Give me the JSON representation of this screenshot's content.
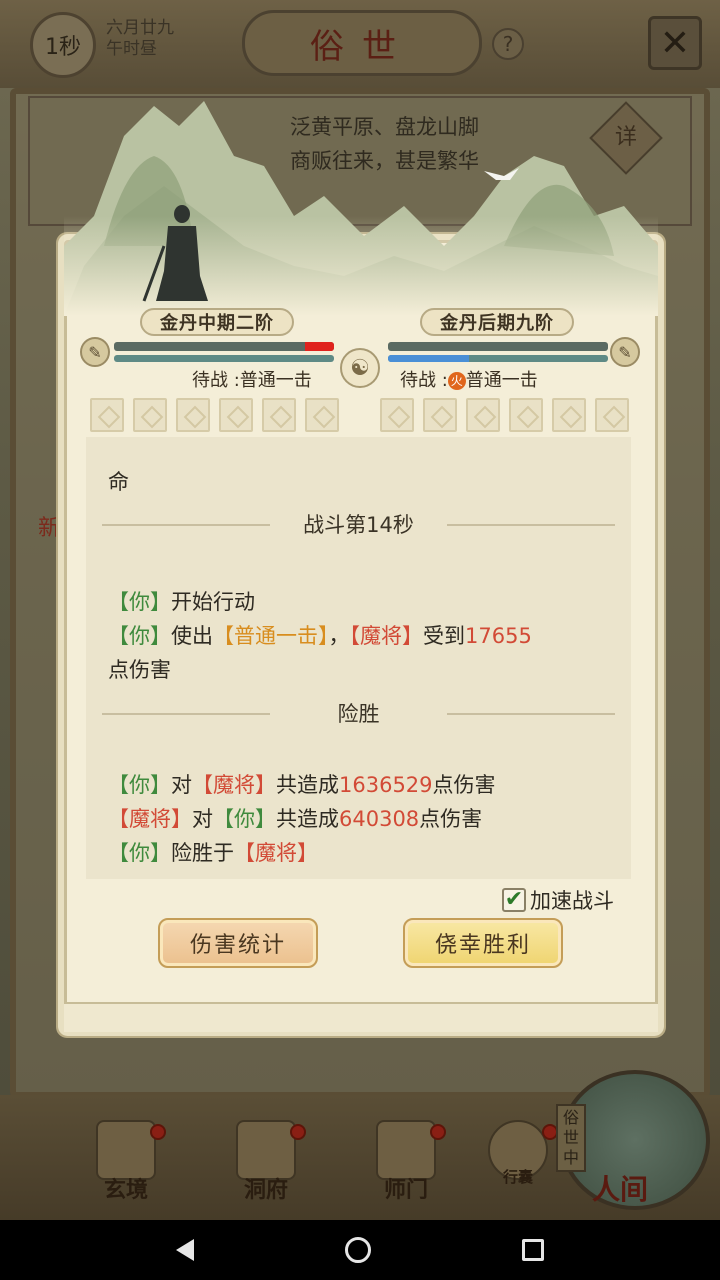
{
  "top_bar": {
    "timer": "1秒",
    "date_line1": "六月廿九",
    "date_line2": "午时昼",
    "title": "俗世",
    "help": "?",
    "close": "✕"
  },
  "location": {
    "line1": "泛黄平原、盘龙山脚",
    "line2": "商贩往来，甚是繁华",
    "detail": "详"
  },
  "background_side_text": "新",
  "battle": {
    "player_realm": "金丹中期二阶",
    "enemy_realm": "金丹后期九阶",
    "player_pending": "待战 :普通一击",
    "enemy_pending_prefix": "待战 :",
    "enemy_pending_skill": "普通一击",
    "player_hp_lost_fraction": 0.13,
    "enemy_mp_fraction": 0.37,
    "log": {
      "truncated_line": "命",
      "round_header": "战斗第14秒",
      "act1_you": "【你】",
      "act1_text": "开始行动",
      "act2_you": "【你】",
      "act2_use": "使出",
      "act2_skill": "【普通一击】",
      "act2_comma": "，",
      "act2_enemy": "【魔将】",
      "act2_receive": "受到",
      "act2_damage": "17655",
      "act2_tail": "点伤害",
      "result_header": "险胜",
      "sum1_you": "【你】",
      "sum1_to": "对",
      "sum1_enemy": "【魔将】",
      "sum1_total": "共造成",
      "sum1_damage": "1636529",
      "sum1_tail": "点伤害",
      "sum2_enemy": "【魔将】",
      "sum2_to": "对",
      "sum2_you": "【你】",
      "sum2_total": "共造成",
      "sum2_damage": "640308",
      "sum2_tail": "点伤害",
      "sum3_you": "【你】",
      "sum3_text": "险胜于",
      "sum3_enemy": "【魔将】"
    },
    "speed_checkbox_label": "加速战斗",
    "speed_checked": true,
    "btn_stats": "伤害统计",
    "btn_win": "侥幸胜利"
  },
  "bottom_nav": {
    "items": [
      {
        "label": "玄境"
      },
      {
        "label": "洞府"
      },
      {
        "label": "师门"
      },
      {
        "label": "行囊"
      }
    ],
    "world_tag": "俗世中",
    "world_label": "人间"
  },
  "colors": {
    "ally": "#3f8a3d",
    "enemy": "#d24a36",
    "skill": "#d88d1e"
  }
}
